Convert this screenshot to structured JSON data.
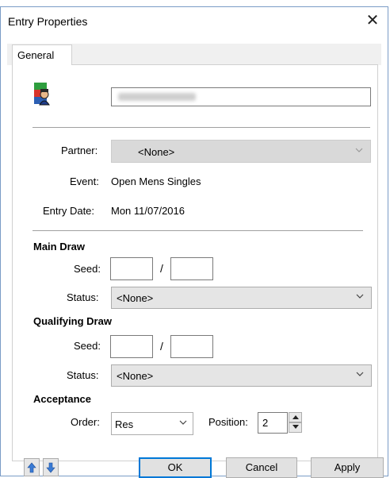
{
  "window": {
    "title": "Entry Properties",
    "close_glyph": "✕"
  },
  "tabs": [
    {
      "label": "General"
    }
  ],
  "entry": {
    "name_value": "",
    "partner_label": "Partner:",
    "partner_value": "<None>",
    "event_label": "Event:",
    "event_value": "Open Mens Singles",
    "entry_date_label": "Entry Date:",
    "entry_date_value": "Mon 11/07/2016"
  },
  "main_draw": {
    "title": "Main Draw",
    "seed_label": "Seed:",
    "seed_separator": "/",
    "status_label": "Status:",
    "status_value": "<None>"
  },
  "qualifying_draw": {
    "title": "Qualifying Draw",
    "seed_label": "Seed:",
    "seed_separator": "/",
    "status_label": "Status:",
    "status_value": "<None>"
  },
  "acceptance": {
    "title": "Acceptance",
    "order_label": "Order:",
    "order_value": "Res",
    "position_label": "Position:",
    "position_value": "2"
  },
  "buttons": {
    "ok": "OK",
    "cancel": "Cancel",
    "apply": "Apply"
  },
  "icons": {
    "avatar": "user-card-icon",
    "up": "arrow-up-icon",
    "down": "arrow-down-icon",
    "chevron": "chevron-down-icon"
  },
  "colors": {
    "accent": "#0078d7",
    "nav_arrow": "#3a7bd5"
  }
}
